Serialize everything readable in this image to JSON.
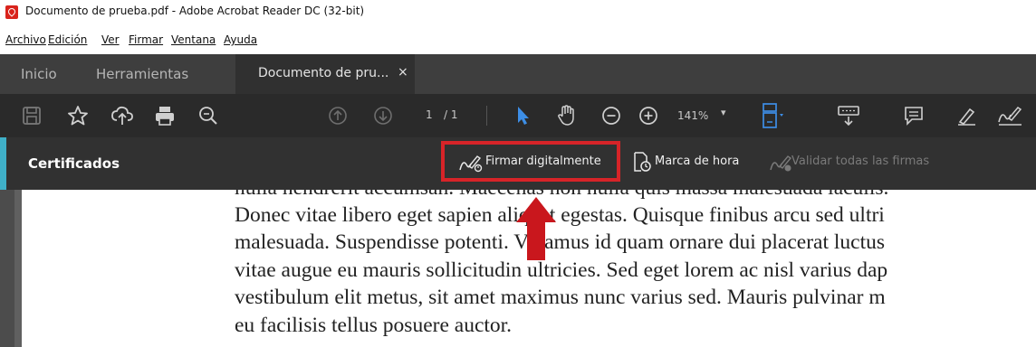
{
  "window": {
    "title": "Documento de prueba.pdf - Adobe Acrobat Reader DC (32-bit)"
  },
  "menu": {
    "items": [
      "Archivo",
      "Edición",
      "Ver",
      "Firmar",
      "Ventana",
      "Ayuda"
    ]
  },
  "tabs": {
    "home": "Inicio",
    "tools": "Herramientas",
    "document": "Documento de pru...",
    "close": "×"
  },
  "toolbar": {
    "page_current": "1",
    "page_total": "/ 1",
    "zoom": "141%"
  },
  "certificates": {
    "title": "Certificados",
    "sign_digitally": "Firmar digitalmente",
    "timestamp": "Marca de hora",
    "validate_all": "Validar todas las firmas"
  },
  "document": {
    "lines": [
      "nulla hendrerit accumsan. Maecenas non nulla quis massa malesuada iaculis.",
      "Donec vitae libero eget sapien aliquet egestas. Quisque finibus arcu sed ultri",
      "malesuada. Suspendisse potenti. Vivamus id quam ornare dui placerat luctus",
      "vitae augue eu mauris sollicitudin ultricies. Sed eget lorem ac nisl varius dap",
      "vestibulum elit metus, sit amet maximus nunc varius sed. Mauris pulvinar m",
      "eu facilisis tellus posuere auctor."
    ]
  },
  "colors": {
    "highlight": "#d72428",
    "accent": "#3fb0c8",
    "select_tool": "#3d8ee6"
  }
}
